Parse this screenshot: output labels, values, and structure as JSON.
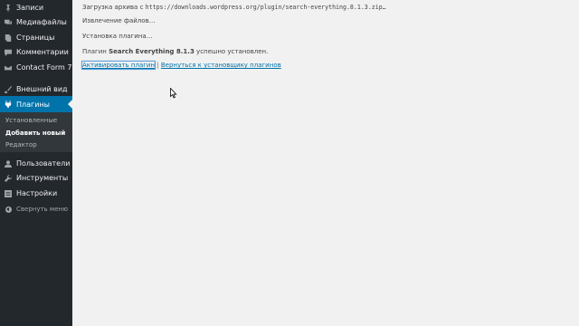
{
  "sidebar": {
    "items": [
      {
        "label": "Записи",
        "icon": "pin-icon"
      },
      {
        "label": "Медиафайлы",
        "icon": "media-icon"
      },
      {
        "label": "Страницы",
        "icon": "pages-icon"
      },
      {
        "label": "Комментарии",
        "icon": "comments-icon"
      },
      {
        "label": "Contact Form 7",
        "icon": "mail-icon"
      },
      {
        "label": "Внешний вид",
        "icon": "brush-icon"
      },
      {
        "label": "Плагины",
        "icon": "plugin-icon"
      },
      {
        "label": "Пользователи",
        "icon": "users-icon"
      },
      {
        "label": "Инструменты",
        "icon": "wrench-icon"
      },
      {
        "label": "Настройки",
        "icon": "settings-icon"
      }
    ],
    "submenu": [
      "Установленные",
      "Добавить новый",
      "Редактор"
    ],
    "collapse_label": "Свернуть меню"
  },
  "main": {
    "download_prefix": "Загрузка архива с",
    "download_url": "https://downloads.wordpress.org/plugin/search-everything.8.1.3.zip…",
    "extracting": "Извлечение файлов…",
    "installing": "Установка плагина…",
    "success_prefix": "Плагин",
    "plugin_name": "Search Everything 8.1.3",
    "success_suffix": "успешно установлен.",
    "activate_link": "Активировать плагин",
    "separator": "|",
    "return_link": "Вернуться к установщику плагинов"
  },
  "colors": {
    "sidebar_bg": "#23282d",
    "active_bg": "#0073aa",
    "link": "#0073aa",
    "content_bg": "#f1f1f1"
  }
}
